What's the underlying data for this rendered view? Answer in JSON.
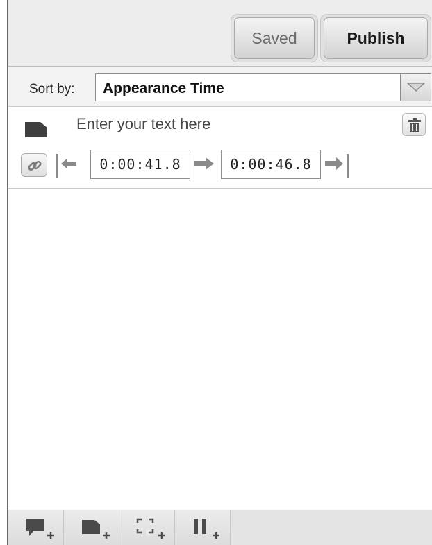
{
  "header": {
    "saved_label": "Saved",
    "publish_label": "Publish"
  },
  "sort": {
    "label": "Sort by:",
    "selected": "Appearance Time"
  },
  "item": {
    "text": "Enter your text here",
    "start_time": "0:00:41.8",
    "end_time": "0:00:46.8"
  },
  "icons": {
    "note": "note-icon",
    "trash": "trash-icon",
    "link": "link-icon",
    "go_to_start": "go-to-start-icon",
    "arrow_right": "arrow-right-icon",
    "go_to_end": "go-to-end-icon",
    "toolbar": [
      "add-speech-bubble-icon",
      "add-note-icon",
      "add-spotlight-icon",
      "add-pause-icon"
    ]
  },
  "colors": {
    "icon_dark": "#4a4a4a",
    "icon_gray": "#8a8a8a",
    "panel_border": "#c9c9c9"
  }
}
